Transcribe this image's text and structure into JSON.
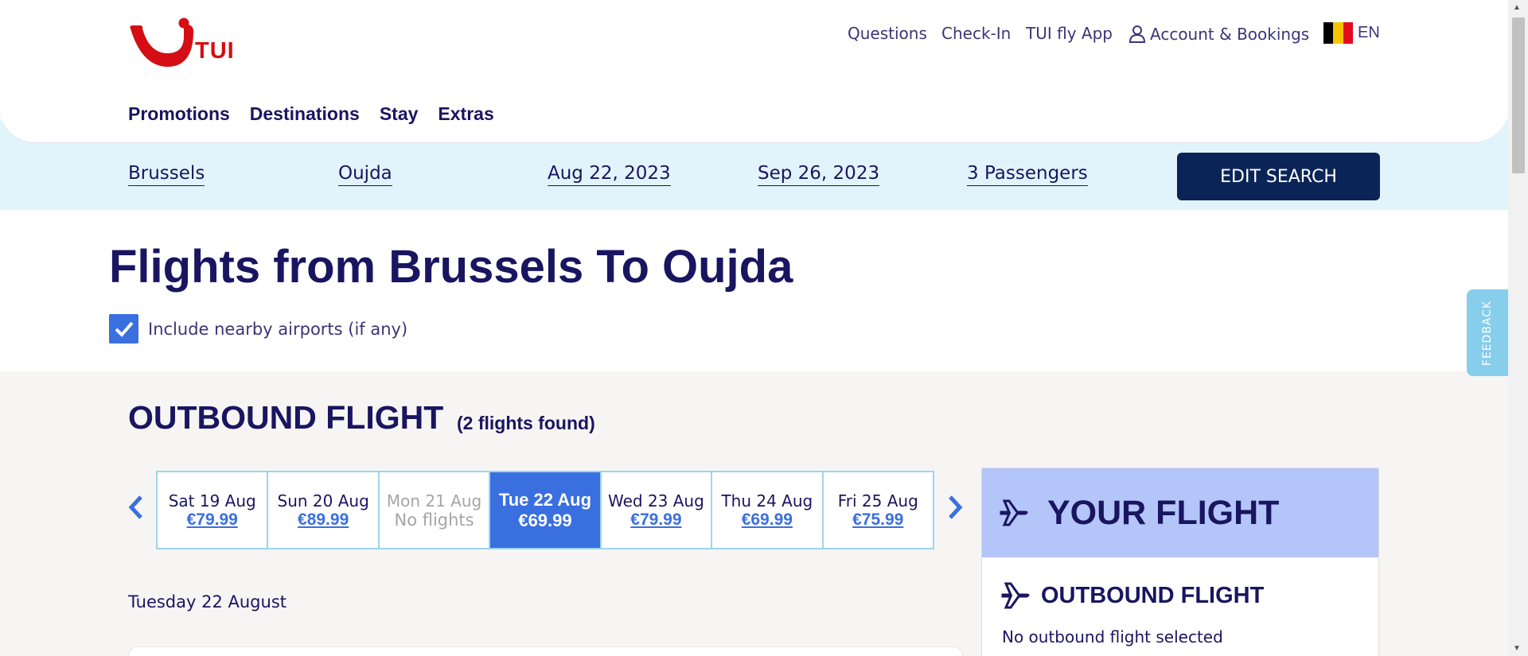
{
  "brand": {
    "name": "TUI",
    "logo_color": "#d40e14"
  },
  "topnav": {
    "questions": "Questions",
    "checkin": "Check-In",
    "app": "TUI fly App",
    "account": "Account & Bookings",
    "language": "EN"
  },
  "mainnav": [
    "Promotions",
    "Destinations",
    "Stay",
    "Extras"
  ],
  "search": {
    "from": "Brussels",
    "to": "Oujda",
    "depart": "Aug 22, 2023",
    "return": "Sep 26, 2023",
    "passengers": "3 Passengers",
    "edit_label": "EDIT SEARCH"
  },
  "page": {
    "title": "Flights from Brussels To Oujda",
    "nearby_label": "Include nearby airports (if any)",
    "nearby_checked": true
  },
  "outbound": {
    "title": "OUTBOUND FLIGHT",
    "count": "(2 flights found)",
    "dates": [
      {
        "day": "Sat 19 Aug",
        "price": "€79.99",
        "state": "available"
      },
      {
        "day": "Sun 20 Aug",
        "price": "€89.99",
        "state": "available"
      },
      {
        "day": "Mon 21 Aug",
        "price": "No flights",
        "state": "disabled"
      },
      {
        "day": "Tue 22 Aug",
        "price": "€69.99",
        "state": "selected"
      },
      {
        "day": "Wed 23 Aug",
        "price": "€79.99",
        "state": "available"
      },
      {
        "day": "Thu 24 Aug",
        "price": "€69.99",
        "state": "available"
      },
      {
        "day": "Fri 25 Aug",
        "price": "€75.99",
        "state": "available"
      }
    ],
    "day_label": "Tuesday 22 August"
  },
  "your_flight": {
    "title": "YOUR FLIGHT",
    "outbound_title": "OUTBOUND FLIGHT",
    "outbound_status": "No outbound flight selected"
  },
  "feedback": "FEEDBACK",
  "colors": {
    "navy": "#1a1560",
    "accent": "#3a6fe0",
    "button": "#0b2458",
    "searchbar_bg": "#e2f4fb",
    "panel_head": "#b4c5f9"
  }
}
